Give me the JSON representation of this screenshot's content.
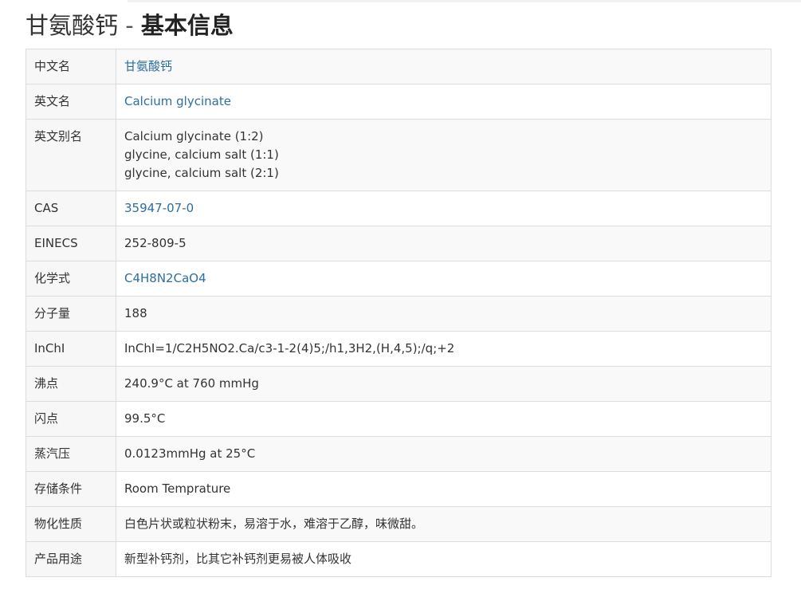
{
  "page": {
    "compound_name": "甘氨酸钙",
    "separator": "-",
    "section_title": "基本信息"
  },
  "rows": {
    "chinese_name": {
      "label": "中文名",
      "value": "甘氨酸钙"
    },
    "english_name": {
      "label": "英文名",
      "value": "Calcium glycinate"
    },
    "synonyms": {
      "label": "英文别名",
      "values": [
        "Calcium glycinate (1:2)",
        "glycine, calcium salt (1:1)",
        "glycine, calcium salt (2:1)"
      ]
    },
    "cas": {
      "label": "CAS",
      "value": "35947-07-0"
    },
    "einecs": {
      "label": "EINECS",
      "value": "252-809-5"
    },
    "formula": {
      "label": "化学式",
      "value": "C4H8N2CaO4"
    },
    "molecular_weight": {
      "label": "分子量",
      "value": "188"
    },
    "inchi": {
      "label": "InChI",
      "value": "InChI=1/C2H5NO2.Ca/c3-1-2(4)5;/h1,3H2,(H,4,5);/q;+2"
    },
    "boiling_point": {
      "label": "沸点",
      "value": "240.9°C at 760 mmHg"
    },
    "flash_point": {
      "label": "闪点",
      "value": "99.5°C"
    },
    "vapor_pressure": {
      "label": "蒸汽压",
      "value": "0.0123mmHg at 25°C"
    },
    "storage": {
      "label": "存储条件",
      "value": "Room Temprature"
    },
    "properties": {
      "label": "物化性质",
      "value": "白色片状或粒状粉末，易溶于水，难溶于乙醇，味微甜。"
    },
    "usage": {
      "label": "产品用途",
      "value": "新型补钙剂，比其它补钙剂更易被人体吸收"
    }
  },
  "colors": {
    "link": "#2e6e9e",
    "border": "#dcdcdc",
    "label_bg": "#f7f7f7"
  }
}
